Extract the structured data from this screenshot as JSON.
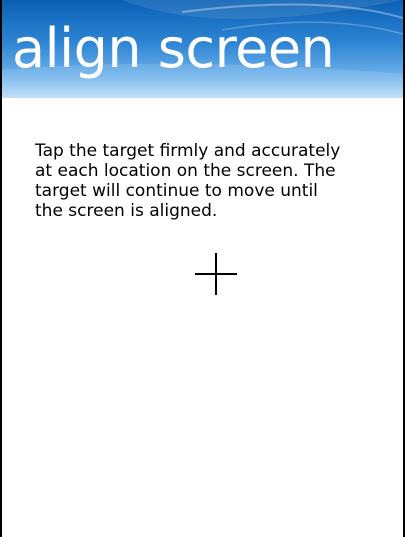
{
  "header": {
    "title": "align screen"
  },
  "instructions": {
    "lines": [
      "Tap the target firmly and accurately",
      "at each location on the screen. The",
      "target will continue to move until",
      "the screen is aligned."
    ]
  },
  "target": {
    "icon": "crosshair-icon"
  },
  "colors": {
    "header_top": "#0a5fb4",
    "header_bottom": "#b9dcf7",
    "header_text": "#ffffff",
    "background": "#ffffff",
    "text": "#000000"
  }
}
